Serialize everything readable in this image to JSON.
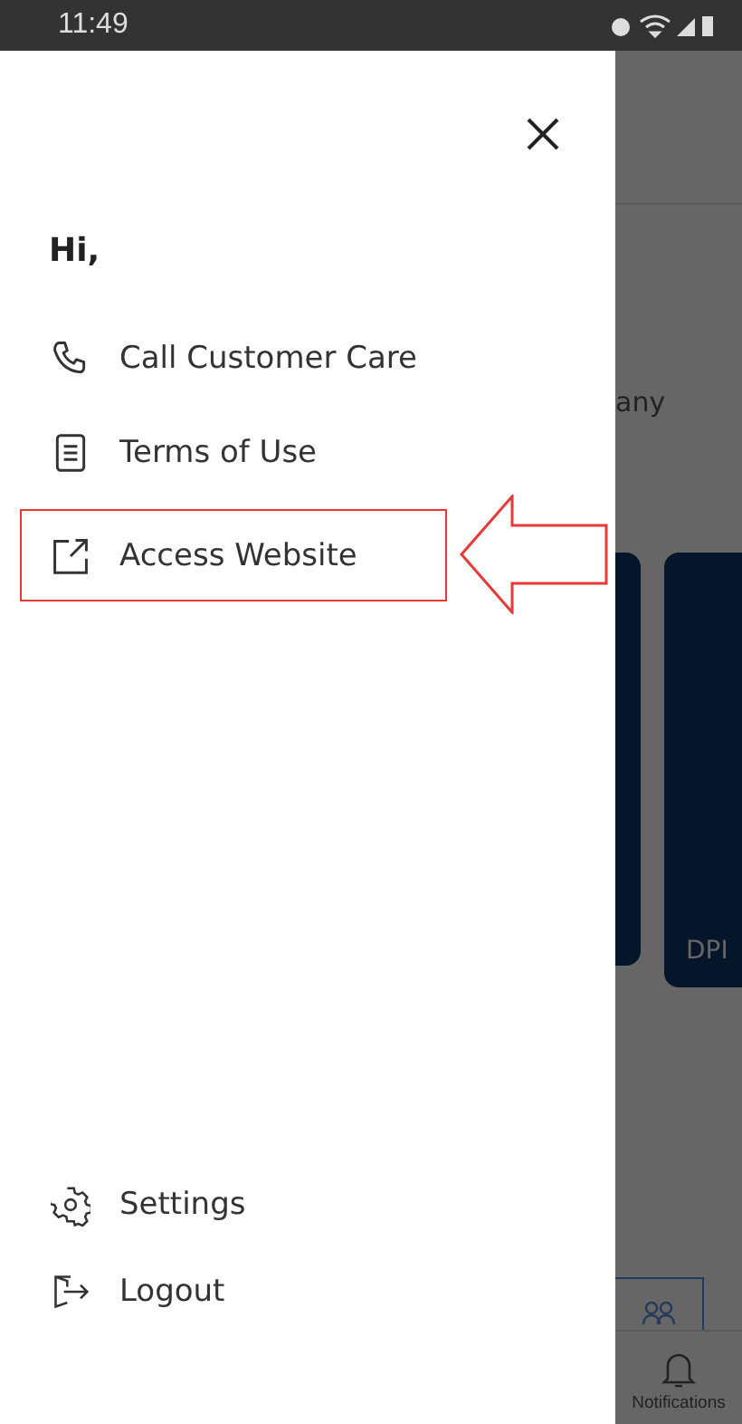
{
  "status_bar": {
    "time": "11:49"
  },
  "drawer": {
    "greeting": "Hi,",
    "menu": [
      {
        "kind": "phone",
        "label": "Call Customer Care",
        "highlighted": false
      },
      {
        "kind": "document",
        "label": "Terms of Use",
        "highlighted": false
      },
      {
        "kind": "external",
        "label": "Access Website",
        "highlighted": true
      }
    ],
    "footer_menu": [
      {
        "kind": "gear",
        "label": "Settings"
      },
      {
        "kind": "logout",
        "label": "Logout"
      }
    ]
  },
  "background": {
    "text_fragment": "any",
    "card_text": "DPI",
    "tab_label": "Notifications"
  }
}
